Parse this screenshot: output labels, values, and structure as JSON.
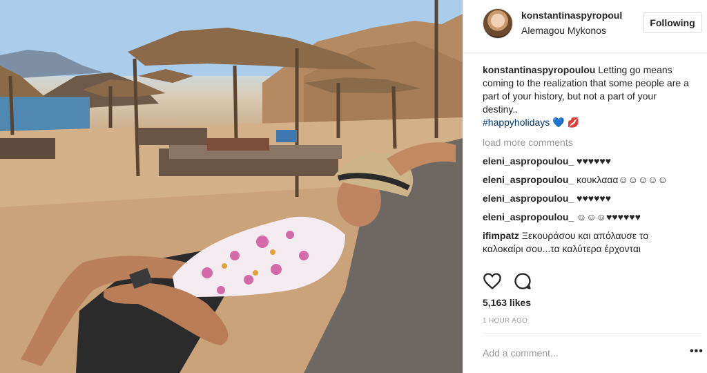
{
  "post": {
    "photo_alt": "Woman relaxing on a sunbed at a beach with straw umbrellas",
    "username": "konstantinaspyropoul",
    "location": "Alemagou Mykonos",
    "follow_label": "Following",
    "caption": {
      "user": "konstantinaspyropoulou",
      "text": " Letting go means coming to the realization that some people are a part of your history, but not a part of your destiny..",
      "tags": "#happyholidays 💙 💋"
    },
    "load_more": "load more comments",
    "comments": [
      {
        "user": "eleni_aspropoulou_",
        "text": " ♥♥♥♥♥♥"
      },
      {
        "user": "eleni_aspropoulou_",
        "text": " κουκλααα☺☺☺☺☺"
      },
      {
        "user": "eleni_aspropoulou_",
        "text": " ♥♥♥♥♥♥"
      },
      {
        "user": "eleni_aspropoulou_",
        "text": " ☺☺☺♥♥♥♥♥♥"
      },
      {
        "user": "ifimpatz",
        "text": " Ξεκουράσου και απόλαυσε το καλοκαίρι σου...τα καλύτερα έρχονται"
      }
    ],
    "likes": "5,163 likes",
    "time": "1 HOUR AGO",
    "add_comment_placeholder": "Add a comment...",
    "more_label": "•••",
    "icons": {
      "like": "heart-icon",
      "comment": "comment-icon"
    }
  }
}
